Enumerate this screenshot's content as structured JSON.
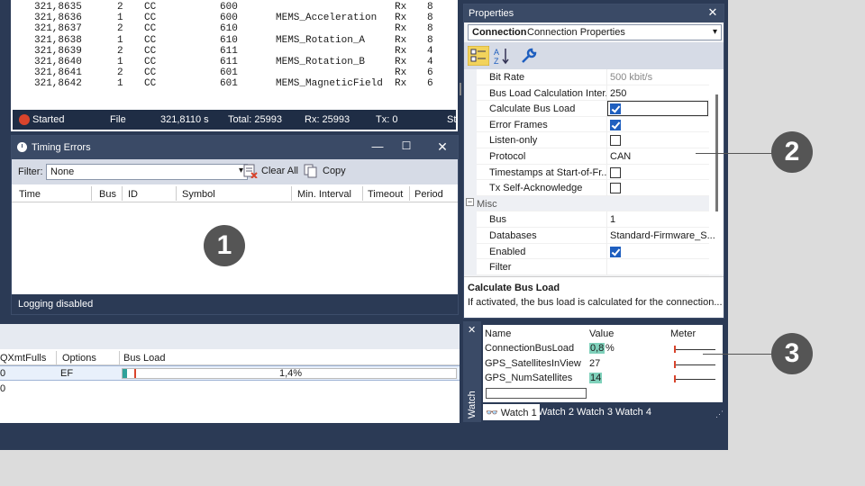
{
  "trace": {
    "rows": [
      {
        "time": "321,8635",
        "ch": "2",
        "id": "CC",
        "dlc": "600",
        "name": "",
        "dir": "Rx",
        "len": "8"
      },
      {
        "time": "321,8636",
        "ch": "1",
        "id": "CC",
        "dlc": "600",
        "name": "MEMS_Acceleration",
        "dir": "Rx",
        "len": "8"
      },
      {
        "time": "321,8637",
        "ch": "2",
        "id": "CC",
        "dlc": "610",
        "name": "",
        "dir": "Rx",
        "len": "8"
      },
      {
        "time": "321,8638",
        "ch": "1",
        "id": "CC",
        "dlc": "610",
        "name": "MEMS_Rotation_A",
        "dir": "Rx",
        "len": "8"
      },
      {
        "time": "321,8639",
        "ch": "2",
        "id": "CC",
        "dlc": "611",
        "name": "",
        "dir": "Rx",
        "len": "4"
      },
      {
        "time": "321,8640",
        "ch": "1",
        "id": "CC",
        "dlc": "611",
        "name": "MEMS_Rotation_B",
        "dir": "Rx",
        "len": "4"
      },
      {
        "time": "321,8641",
        "ch": "2",
        "id": "CC",
        "dlc": "601",
        "name": "",
        "dir": "Rx",
        "len": "6"
      },
      {
        "time": "321,8642",
        "ch": "1",
        "id": "CC",
        "dlc": "601",
        "name": "MEMS_MagneticField",
        "dir": "Rx",
        "len": "6"
      }
    ],
    "status": {
      "state": "Started",
      "mode": "File",
      "time": "321,8110 s",
      "total": "Total: 25993",
      "rx": "Rx: 25993",
      "tx": "Tx: 0",
      "cut": "St"
    }
  },
  "timing_errors": {
    "title": "Timing Errors",
    "filter_label": "Filter:",
    "filter_value": "None",
    "clear_all": "Clear All",
    "copy": "Copy",
    "columns": [
      "Time",
      "Bus",
      "ID",
      "Symbol",
      "Min. Interval",
      "Timeout",
      "Period"
    ],
    "footer": "Logging disabled",
    "badge": "1"
  },
  "bus_window": {
    "columns": [
      "QXmtFulls",
      "Options",
      "Bus Load"
    ],
    "row": {
      "qxmt": "0",
      "options": "EF",
      "bus_load": "1,4%",
      "bus_load_value": 1.4
    },
    "row2": {
      "qxmt": "0"
    }
  },
  "properties": {
    "title": "Properties",
    "object_name": "Connection",
    "object_type": "Connection Properties",
    "rows": [
      {
        "key": "Bit Rate",
        "value": "500 kbit/s",
        "type": "text",
        "dim": true
      },
      {
        "key": "Bus Load Calculation Inter...",
        "value": "250",
        "type": "text"
      },
      {
        "key": "Calculate Bus Load",
        "type": "check",
        "checked": true,
        "selected": true
      },
      {
        "key": "Error Frames",
        "type": "check",
        "checked": true
      },
      {
        "key": "Listen-only",
        "type": "check",
        "checked": false
      },
      {
        "key": "Protocol",
        "value": "CAN",
        "type": "text"
      },
      {
        "key": "Timestamps at Start-of-Fr...",
        "type": "check",
        "checked": false
      },
      {
        "key": "Tx Self-Acknowledge",
        "type": "check",
        "checked": false
      },
      {
        "key": "Misc",
        "type": "category"
      },
      {
        "key": "Bus",
        "value": "1",
        "type": "text"
      },
      {
        "key": "Databases",
        "value": "Standard-Firmware_S...",
        "type": "text"
      },
      {
        "key": "Enabled",
        "type": "check",
        "checked": true
      },
      {
        "key": "Filter",
        "value": "",
        "type": "text"
      }
    ],
    "desc_title": "Calculate Bus Load",
    "desc_text": "If activated, the bus load is calculated for the connection...",
    "badge": "2"
  },
  "watch": {
    "side_label": "Watch",
    "columns": [
      "Name",
      "Value",
      "Meter"
    ],
    "rows": [
      {
        "name": "ConnectionBusLoad",
        "value": "0,8",
        "unit": "%",
        "highlight": true
      },
      {
        "name": "GPS_SatellitesInView",
        "value": "27",
        "unit": "",
        "highlight": false
      },
      {
        "name": "GPS_NumSatellites",
        "value": "14",
        "unit": "",
        "highlight": true
      }
    ],
    "tabs": [
      "Watch 1",
      "Watch 2",
      "Watch 3",
      "Watch 4"
    ],
    "badge": "3"
  },
  "colors": {
    "app_bg": "#2b3a55",
    "title_bar": "#3a4a66",
    "accent_teal": "#2fa19a",
    "marker_red": "#d9442c",
    "check_blue": "#1f5fbf"
  }
}
